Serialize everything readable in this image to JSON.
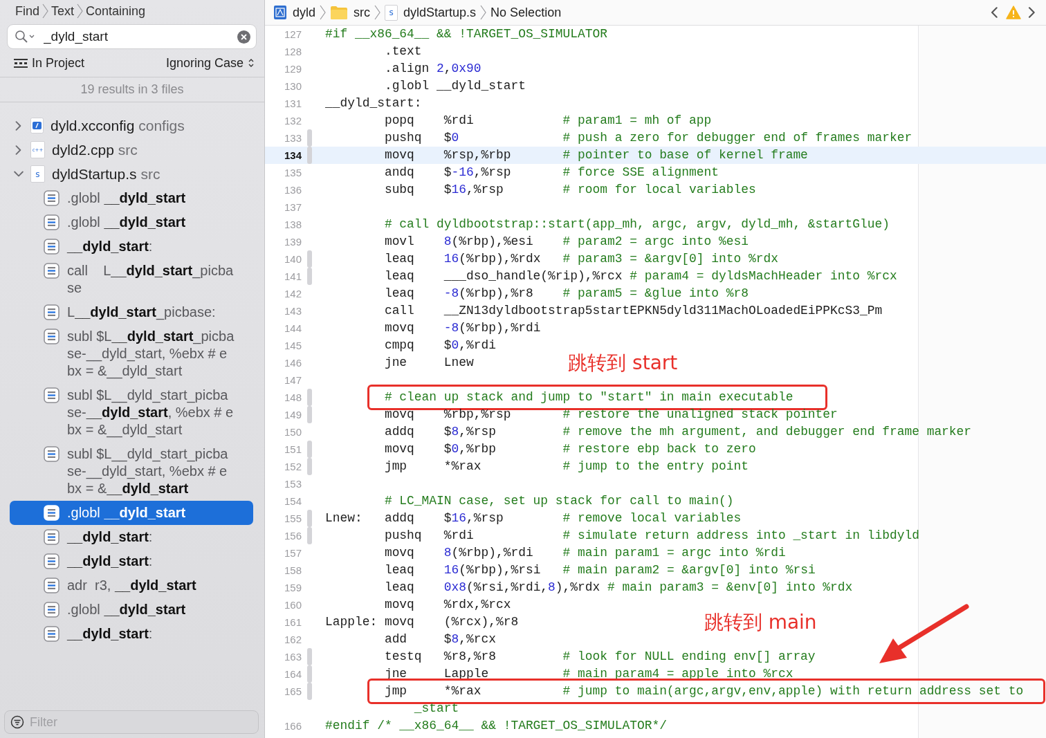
{
  "find_bar": {
    "breadcrumb": [
      "Find",
      "Text",
      "Containing"
    ]
  },
  "search": {
    "value": "_dyld_start"
  },
  "scope": {
    "label": "In Project",
    "option": "Ignoring Case"
  },
  "summary": "19 results in 3 files",
  "results": [
    {
      "file": "dyld.xcconfig",
      "folder": "configs",
      "kind": "xcconfig",
      "expanded": false
    },
    {
      "file": "dyld2.cpp",
      "folder": "src",
      "kind": "cpp",
      "icon_text": "c++",
      "expanded": false
    },
    {
      "file": "dyldStartup.s",
      "folder": "src",
      "kind": "asm",
      "icon_text": "s",
      "expanded": true,
      "children": [
        {
          "text": ".globl **__dyld_start**",
          "selected": false
        },
        {
          "text": ".globl **__dyld_start**",
          "selected": false
        },
        {
          "text": "**__dyld_start**:",
          "selected": false
        },
        {
          "text": "call    L**__dyld_start**_picbase",
          "selected": false
        },
        {
          "text": "L**__dyld_start**_picbase:",
          "selected": false
        },
        {
          "text": "subl $L**__dyld_start**_picbase-__dyld_start, %ebx # ebx = &__dyld_start",
          "selected": false
        },
        {
          "text": "subl $L__dyld_start_picbase-**__dyld_start**, %ebx # ebx = &__dyld_start",
          "selected": false
        },
        {
          "text": "subl $L__dyld_start_picbase-__dyld_start, %ebx # ebx = &**__dyld_start**",
          "selected": false
        },
        {
          "text": ".globl **__dyld_start**",
          "selected": true
        },
        {
          "text": "**__dyld_start**:",
          "selected": false
        },
        {
          "text": "**__dyld_start**:",
          "selected": false
        },
        {
          "text": "adr  r3, **__dyld_start**",
          "selected": false
        },
        {
          "text": ".globl **__dyld_start**",
          "selected": false
        },
        {
          "text": "**__dyld_start**:",
          "selected": false
        }
      ]
    }
  ],
  "filter": {
    "placeholder": "Filter"
  },
  "jump_bar": {
    "path": [
      {
        "label": "dyld",
        "kind": "project"
      },
      {
        "label": "src",
        "kind": "folder"
      },
      {
        "label": "dyldStartup.s",
        "kind": "asm",
        "icon_text": "s"
      },
      {
        "label": "No Selection",
        "kind": "none"
      }
    ],
    "warning": true
  },
  "editor": {
    "lines": [
      {
        "number": "127",
        "spans": [
          {
            "kind": "directive",
            "text": "#if __x86_64__ && !TARGET_OS_SIMULATOR"
          }
        ],
        "current": false,
        "changed": false,
        "boxed": false
      },
      {
        "number": "128",
        "spans": [
          {
            "kind": "plain",
            "text": "        .text"
          }
        ],
        "current": false,
        "changed": false,
        "boxed": false
      },
      {
        "number": "129",
        "spans": [
          {
            "kind": "plain",
            "text": "        .align "
          },
          {
            "kind": "number",
            "text": "2"
          },
          {
            "kind": "plain",
            "text": ","
          },
          {
            "kind": "number",
            "text": "0x90"
          }
        ],
        "current": false,
        "changed": false,
        "boxed": false
      },
      {
        "number": "130",
        "spans": [
          {
            "kind": "plain",
            "text": "        .globl __dyld_start"
          }
        ],
        "current": false,
        "changed": false,
        "boxed": false
      },
      {
        "number": "131",
        "spans": [
          {
            "kind": "plain",
            "text": "__dyld_start:"
          }
        ],
        "current": false,
        "changed": false,
        "boxed": false
      },
      {
        "number": "132",
        "spans": [
          {
            "kind": "plain",
            "text": "        popq    %rdi"
          },
          {
            "kind": "comment",
            "text": "            # param1 = mh of app"
          }
        ],
        "current": false,
        "changed": false,
        "boxed": false
      },
      {
        "number": "133",
        "spans": [
          {
            "kind": "plain",
            "text": "        pushq   $"
          },
          {
            "kind": "number",
            "text": "0"
          },
          {
            "kind": "comment",
            "text": "              # push a zero for debugger end of frames marker"
          }
        ],
        "current": false,
        "changed": true,
        "boxed": false
      },
      {
        "number": "134",
        "spans": [
          {
            "kind": "plain",
            "text": "        movq    %rsp,%rbp"
          },
          {
            "kind": "comment",
            "text": "       # pointer to base of kernel frame"
          }
        ],
        "current": true,
        "changed": true,
        "boxed": false
      },
      {
        "number": "135",
        "spans": [
          {
            "kind": "plain",
            "text": "        andq    $"
          },
          {
            "kind": "number",
            "text": "-16"
          },
          {
            "kind": "plain",
            "text": ",%rsp"
          },
          {
            "kind": "comment",
            "text": "       # force SSE alignment"
          }
        ],
        "current": false,
        "changed": false,
        "boxed": false
      },
      {
        "number": "136",
        "spans": [
          {
            "kind": "plain",
            "text": "        subq    $"
          },
          {
            "kind": "number",
            "text": "16"
          },
          {
            "kind": "plain",
            "text": ",%rsp"
          },
          {
            "kind": "comment",
            "text": "        # room for local variables"
          }
        ],
        "current": false,
        "changed": false,
        "boxed": false
      },
      {
        "number": "137",
        "current": false,
        "changed": false,
        "boxed": false
      },
      {
        "number": "138",
        "spans": [
          {
            "kind": "comment",
            "text": "        # call dyldbootstrap::start(app_mh, argc, argv, dyld_mh, &startGlue)"
          }
        ],
        "current": false,
        "changed": false,
        "boxed": false
      },
      {
        "number": "139",
        "spans": [
          {
            "kind": "plain",
            "text": "        movl    "
          },
          {
            "kind": "number",
            "text": "8"
          },
          {
            "kind": "plain",
            "text": "(%rbp),%esi"
          },
          {
            "kind": "comment",
            "text": "    # param2 = argc into %esi"
          }
        ],
        "current": false,
        "changed": false,
        "boxed": false
      },
      {
        "number": "140",
        "spans": [
          {
            "kind": "plain",
            "text": "        leaq    "
          },
          {
            "kind": "number",
            "text": "16"
          },
          {
            "kind": "plain",
            "text": "(%rbp),%rdx"
          },
          {
            "kind": "comment",
            "text": "   # param3 = &argv[0] into %rdx"
          }
        ],
        "current": false,
        "changed": true,
        "boxed": false
      },
      {
        "number": "141",
        "spans": [
          {
            "kind": "plain",
            "text": "        leaq    ___dso_handle(%rip),%rcx"
          },
          {
            "kind": "comment",
            "text": " # param4 = dyldsMachHeader into %rcx"
          }
        ],
        "current": false,
        "changed": true,
        "boxed": false
      },
      {
        "number": "142",
        "spans": [
          {
            "kind": "plain",
            "text": "        leaq    "
          },
          {
            "kind": "number",
            "text": "-8"
          },
          {
            "kind": "plain",
            "text": "(%rbp),%r8"
          },
          {
            "kind": "comment",
            "text": "    # param5 = &glue into %r8"
          }
        ],
        "current": false,
        "changed": false,
        "boxed": false
      },
      {
        "number": "143",
        "spans": [
          {
            "kind": "plain",
            "text": "        call    __ZN13dyldbootstrap5startEPKN5dyld311MachOLoadedEiPPKcS3_Pm"
          }
        ],
        "current": false,
        "changed": false,
        "boxed": false
      },
      {
        "number": "144",
        "spans": [
          {
            "kind": "plain",
            "text": "        movq    "
          },
          {
            "kind": "number",
            "text": "-8"
          },
          {
            "kind": "plain",
            "text": "(%rbp),%rdi"
          }
        ],
        "current": false,
        "changed": false,
        "boxed": false
      },
      {
        "number": "145",
        "spans": [
          {
            "kind": "plain",
            "text": "        cmpq    $"
          },
          {
            "kind": "number",
            "text": "0"
          },
          {
            "kind": "plain",
            "text": ",%rdi"
          }
        ],
        "current": false,
        "changed": false,
        "boxed": false
      },
      {
        "number": "146",
        "spans": [
          {
            "kind": "plain",
            "text": "        jne     Lnew"
          }
        ],
        "current": false,
        "changed": false,
        "boxed": false,
        "note": {
          "text": "跳转到 start",
          "arrow": false
        }
      },
      {
        "number": "147",
        "current": false,
        "changed": false,
        "boxed": false
      },
      {
        "number": "148",
        "spans": [
          {
            "kind": "comment",
            "text": "        # clean up stack and jump to \"start\" in main executable"
          }
        ],
        "current": false,
        "changed": true,
        "boxed": true
      },
      {
        "number": "149",
        "spans": [
          {
            "kind": "plain",
            "text": "        movq    %rbp,%rsp"
          },
          {
            "kind": "comment",
            "text": "       # restore the unaligned stack pointer"
          }
        ],
        "current": false,
        "changed": true,
        "boxed": false
      },
      {
        "number": "150",
        "spans": [
          {
            "kind": "plain",
            "text": "        addq    $"
          },
          {
            "kind": "number",
            "text": "8"
          },
          {
            "kind": "plain",
            "text": ",%rsp"
          },
          {
            "kind": "comment",
            "text": "         # remove the mh argument, and debugger end frame marker"
          }
        ],
        "current": false,
        "changed": false,
        "boxed": false
      },
      {
        "number": "151",
        "spans": [
          {
            "kind": "plain",
            "text": "        movq    $"
          },
          {
            "kind": "number",
            "text": "0"
          },
          {
            "kind": "plain",
            "text": ",%rbp"
          },
          {
            "kind": "comment",
            "text": "         # restore ebp back to zero"
          }
        ],
        "current": false,
        "changed": true,
        "boxed": false
      },
      {
        "number": "152",
        "spans": [
          {
            "kind": "plain",
            "text": "        jmp     *%rax"
          },
          {
            "kind": "comment",
            "text": "           # jump to the entry point"
          }
        ],
        "current": false,
        "changed": true,
        "boxed": false
      },
      {
        "number": "153",
        "current": false,
        "changed": false,
        "boxed": false
      },
      {
        "number": "154",
        "spans": [
          {
            "kind": "comment",
            "text": "        # LC_MAIN case, set up stack for call to main()"
          }
        ],
        "current": false,
        "changed": false,
        "boxed": false
      },
      {
        "number": "155",
        "spans": [
          {
            "kind": "plain",
            "text": "Lnew:   addq    $"
          },
          {
            "kind": "number",
            "text": "16"
          },
          {
            "kind": "plain",
            "text": ",%rsp"
          },
          {
            "kind": "comment",
            "text": "        # remove local variables"
          }
        ],
        "current": false,
        "changed": true,
        "boxed": false
      },
      {
        "number": "156",
        "spans": [
          {
            "kind": "plain",
            "text": "        pushq   %rdi"
          },
          {
            "kind": "comment",
            "text": "            # simulate return address into _start in libdyld"
          }
        ],
        "current": false,
        "changed": true,
        "boxed": false
      },
      {
        "number": "157",
        "spans": [
          {
            "kind": "plain",
            "text": "        movq    "
          },
          {
            "kind": "number",
            "text": "8"
          },
          {
            "kind": "plain",
            "text": "(%rbp),%rdi"
          },
          {
            "kind": "comment",
            "text": "    # main param1 = argc into %rdi"
          }
        ],
        "current": false,
        "changed": false,
        "boxed": false
      },
      {
        "number": "158",
        "spans": [
          {
            "kind": "plain",
            "text": "        leaq    "
          },
          {
            "kind": "number",
            "text": "16"
          },
          {
            "kind": "plain",
            "text": "(%rbp),%rsi"
          },
          {
            "kind": "comment",
            "text": "   # main param2 = &argv[0] into %rsi"
          }
        ],
        "current": false,
        "changed": false,
        "boxed": false
      },
      {
        "number": "159",
        "spans": [
          {
            "kind": "plain",
            "text": "        leaq    "
          },
          {
            "kind": "number",
            "text": "0x8"
          },
          {
            "kind": "plain",
            "text": "(%rsi,%rdi,"
          },
          {
            "kind": "number",
            "text": "8"
          },
          {
            "kind": "plain",
            "text": "),%rdx"
          },
          {
            "kind": "comment",
            "text": " # main param3 = &env[0] into %rdx"
          }
        ],
        "current": false,
        "changed": false,
        "boxed": false
      },
      {
        "number": "160",
        "spans": [
          {
            "kind": "plain",
            "text": "        movq    %rdx,%rcx"
          }
        ],
        "current": false,
        "changed": false,
        "boxed": false
      },
      {
        "number": "161",
        "spans": [
          {
            "kind": "plain",
            "text": "Lapple: movq    (%rcx),%r8"
          }
        ],
        "current": false,
        "changed": false,
        "boxed": false,
        "note": {
          "text": "跳转到 main",
          "arrow": true
        }
      },
      {
        "number": "162",
        "spans": [
          {
            "kind": "plain",
            "text": "        add     $"
          },
          {
            "kind": "number",
            "text": "8"
          },
          {
            "kind": "plain",
            "text": ",%rcx"
          }
        ],
        "current": false,
        "changed": false,
        "boxed": false
      },
      {
        "number": "163",
        "spans": [
          {
            "kind": "plain",
            "text": "        testq   %r8,%r8"
          },
          {
            "kind": "comment",
            "text": "         # look for NULL ending env[] array"
          }
        ],
        "current": false,
        "changed": true,
        "boxed": false
      },
      {
        "number": "164",
        "spans": [
          {
            "kind": "plain",
            "text": "        jne     Lapple"
          },
          {
            "kind": "comment",
            "text": "          # main param4 = apple into %rcx"
          }
        ],
        "current": false,
        "changed": true,
        "boxed": false
      },
      {
        "number": "165",
        "spans": [
          {
            "kind": "plain",
            "text": "        jmp     *%rax"
          },
          {
            "kind": "comment",
            "text": "           # jump to main(argc,argv,env,apple) with return address set to"
          }
        ],
        "continuation": "_start",
        "current": false,
        "changed": true,
        "boxed": true
      },
      {
        "number": "166",
        "spans": [
          {
            "kind": "directive",
            "text": "#endif /* __x86_64__ && !TARGET_OS_SIMULATOR*/"
          }
        ],
        "current": false,
        "changed": false,
        "boxed": false
      }
    ]
  }
}
